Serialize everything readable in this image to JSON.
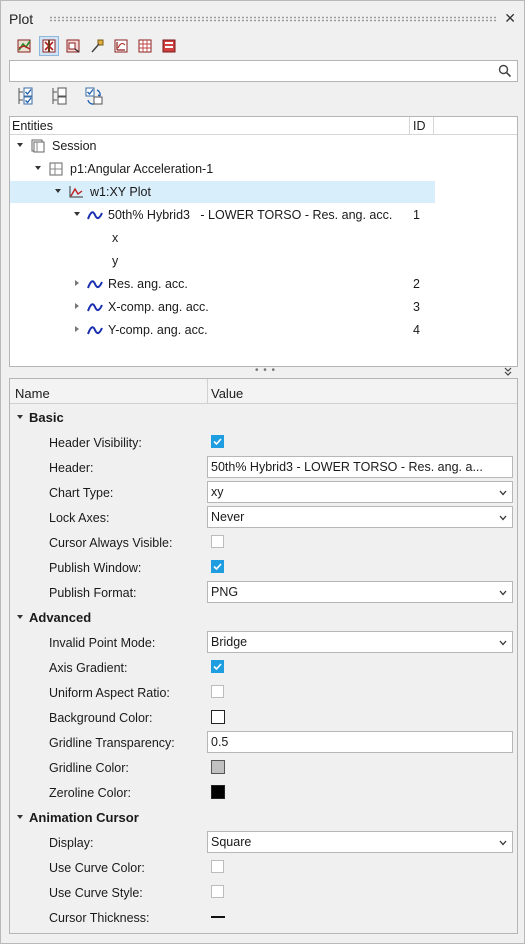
{
  "window": {
    "title": "Plot",
    "close_glyph": "✕"
  },
  "toolbar": {
    "buttons": [
      {
        "icon": "plot-curves-icon"
      },
      {
        "icon": "axis-edit-icon",
        "active": true
      },
      {
        "icon": "page-layout-icon"
      },
      {
        "icon": "pin-marker-icon"
      },
      {
        "icon": "chart-axis-icon"
      },
      {
        "icon": "table-grid-icon"
      },
      {
        "icon": "stack-report-icon"
      }
    ]
  },
  "search": {
    "value": "",
    "placeholder": ""
  },
  "tree_toolbar": {
    "buttons": [
      {
        "icon": "expand-checked-icon"
      },
      {
        "icon": "collapse-tree-icon"
      },
      {
        "icon": "checked-refresh-icon"
      }
    ]
  },
  "entities": {
    "col_entities": "Entities",
    "col_id": "ID",
    "rows": [
      {
        "label": "Session",
        "id": "",
        "icon": "session-icon",
        "depth": 0,
        "expanded": true
      },
      {
        "label": "p1:Angular Acceleration-1",
        "id": "",
        "icon": "page-icon",
        "depth": 1,
        "expanded": true
      },
      {
        "label": "w1:XY Plot",
        "id": "",
        "icon": "xy-plot-icon",
        "depth": 2,
        "expanded": true,
        "selected": true
      },
      {
        "label": "50th% Hybrid3   - LOWER TORSO - Res. ang. acc.",
        "id": "1",
        "icon": "curve-icon",
        "depth": 3,
        "expanded": true
      },
      {
        "label": "x",
        "id": "",
        "icon": "",
        "depth": 4
      },
      {
        "label": "y",
        "id": "",
        "icon": "",
        "depth": 4
      },
      {
        "label": "Res. ang. acc.",
        "id": "2",
        "icon": "curve-icon",
        "depth": 3,
        "expanded": false
      },
      {
        "label": "X-comp. ang. acc.",
        "id": "3",
        "icon": "curve-icon",
        "depth": 3,
        "expanded": false
      },
      {
        "label": "Y-comp. ang. acc.",
        "id": "4",
        "icon": "curve-icon",
        "depth": 3,
        "expanded": false
      }
    ]
  },
  "splitter": {
    "dots": "• • •"
  },
  "properties": {
    "col_name": "Name",
    "col_value": "Value",
    "sections": {
      "basic": "Basic",
      "advanced": "Advanced",
      "animation": "Animation Cursor"
    },
    "header_visibility": {
      "label": "Header Visibility:",
      "checked": true
    },
    "header": {
      "label": "Header:",
      "value": "50th% Hybrid3   - LOWER TORSO - Res. ang. a..."
    },
    "chart_type": {
      "label": "Chart Type:",
      "value": "xy"
    },
    "lock_axes": {
      "label": "Lock Axes:",
      "value": "Never"
    },
    "cursor_always_visible": {
      "label": "Cursor Always Visible:",
      "checked": false
    },
    "publish_window": {
      "label": "Publish Window:",
      "checked": true
    },
    "publish_format": {
      "label": "Publish Format:",
      "value": "PNG"
    },
    "invalid_point_mode": {
      "label": "Invalid Point Mode:",
      "value": "Bridge"
    },
    "axis_gradient": {
      "label": "Axis Gradient:",
      "checked": true
    },
    "uniform_aspect_ratio": {
      "label": "Uniform Aspect Ratio:",
      "checked": false
    },
    "background_color": {
      "label": "Background Color:",
      "color": "#ffffff"
    },
    "gridline_transparency": {
      "label": "Gridline Transparency:",
      "value": "0.5"
    },
    "gridline_color": {
      "label": "Gridline Color:",
      "color": "#c0c0c0"
    },
    "zeroline_color": {
      "label": "Zeroline Color:",
      "color": "#000000"
    },
    "display": {
      "label": "Display:",
      "value": "Square"
    },
    "use_curve_color": {
      "label": "Use Curve Color:",
      "checked": false
    },
    "use_curve_style": {
      "label": "Use Curve Style:",
      "checked": false
    },
    "cursor_thickness": {
      "label": "Cursor Thickness:"
    }
  },
  "colors": {
    "accent": "#1e9de0",
    "selection": "#d9eefb",
    "curve": "#1a2fb0"
  }
}
